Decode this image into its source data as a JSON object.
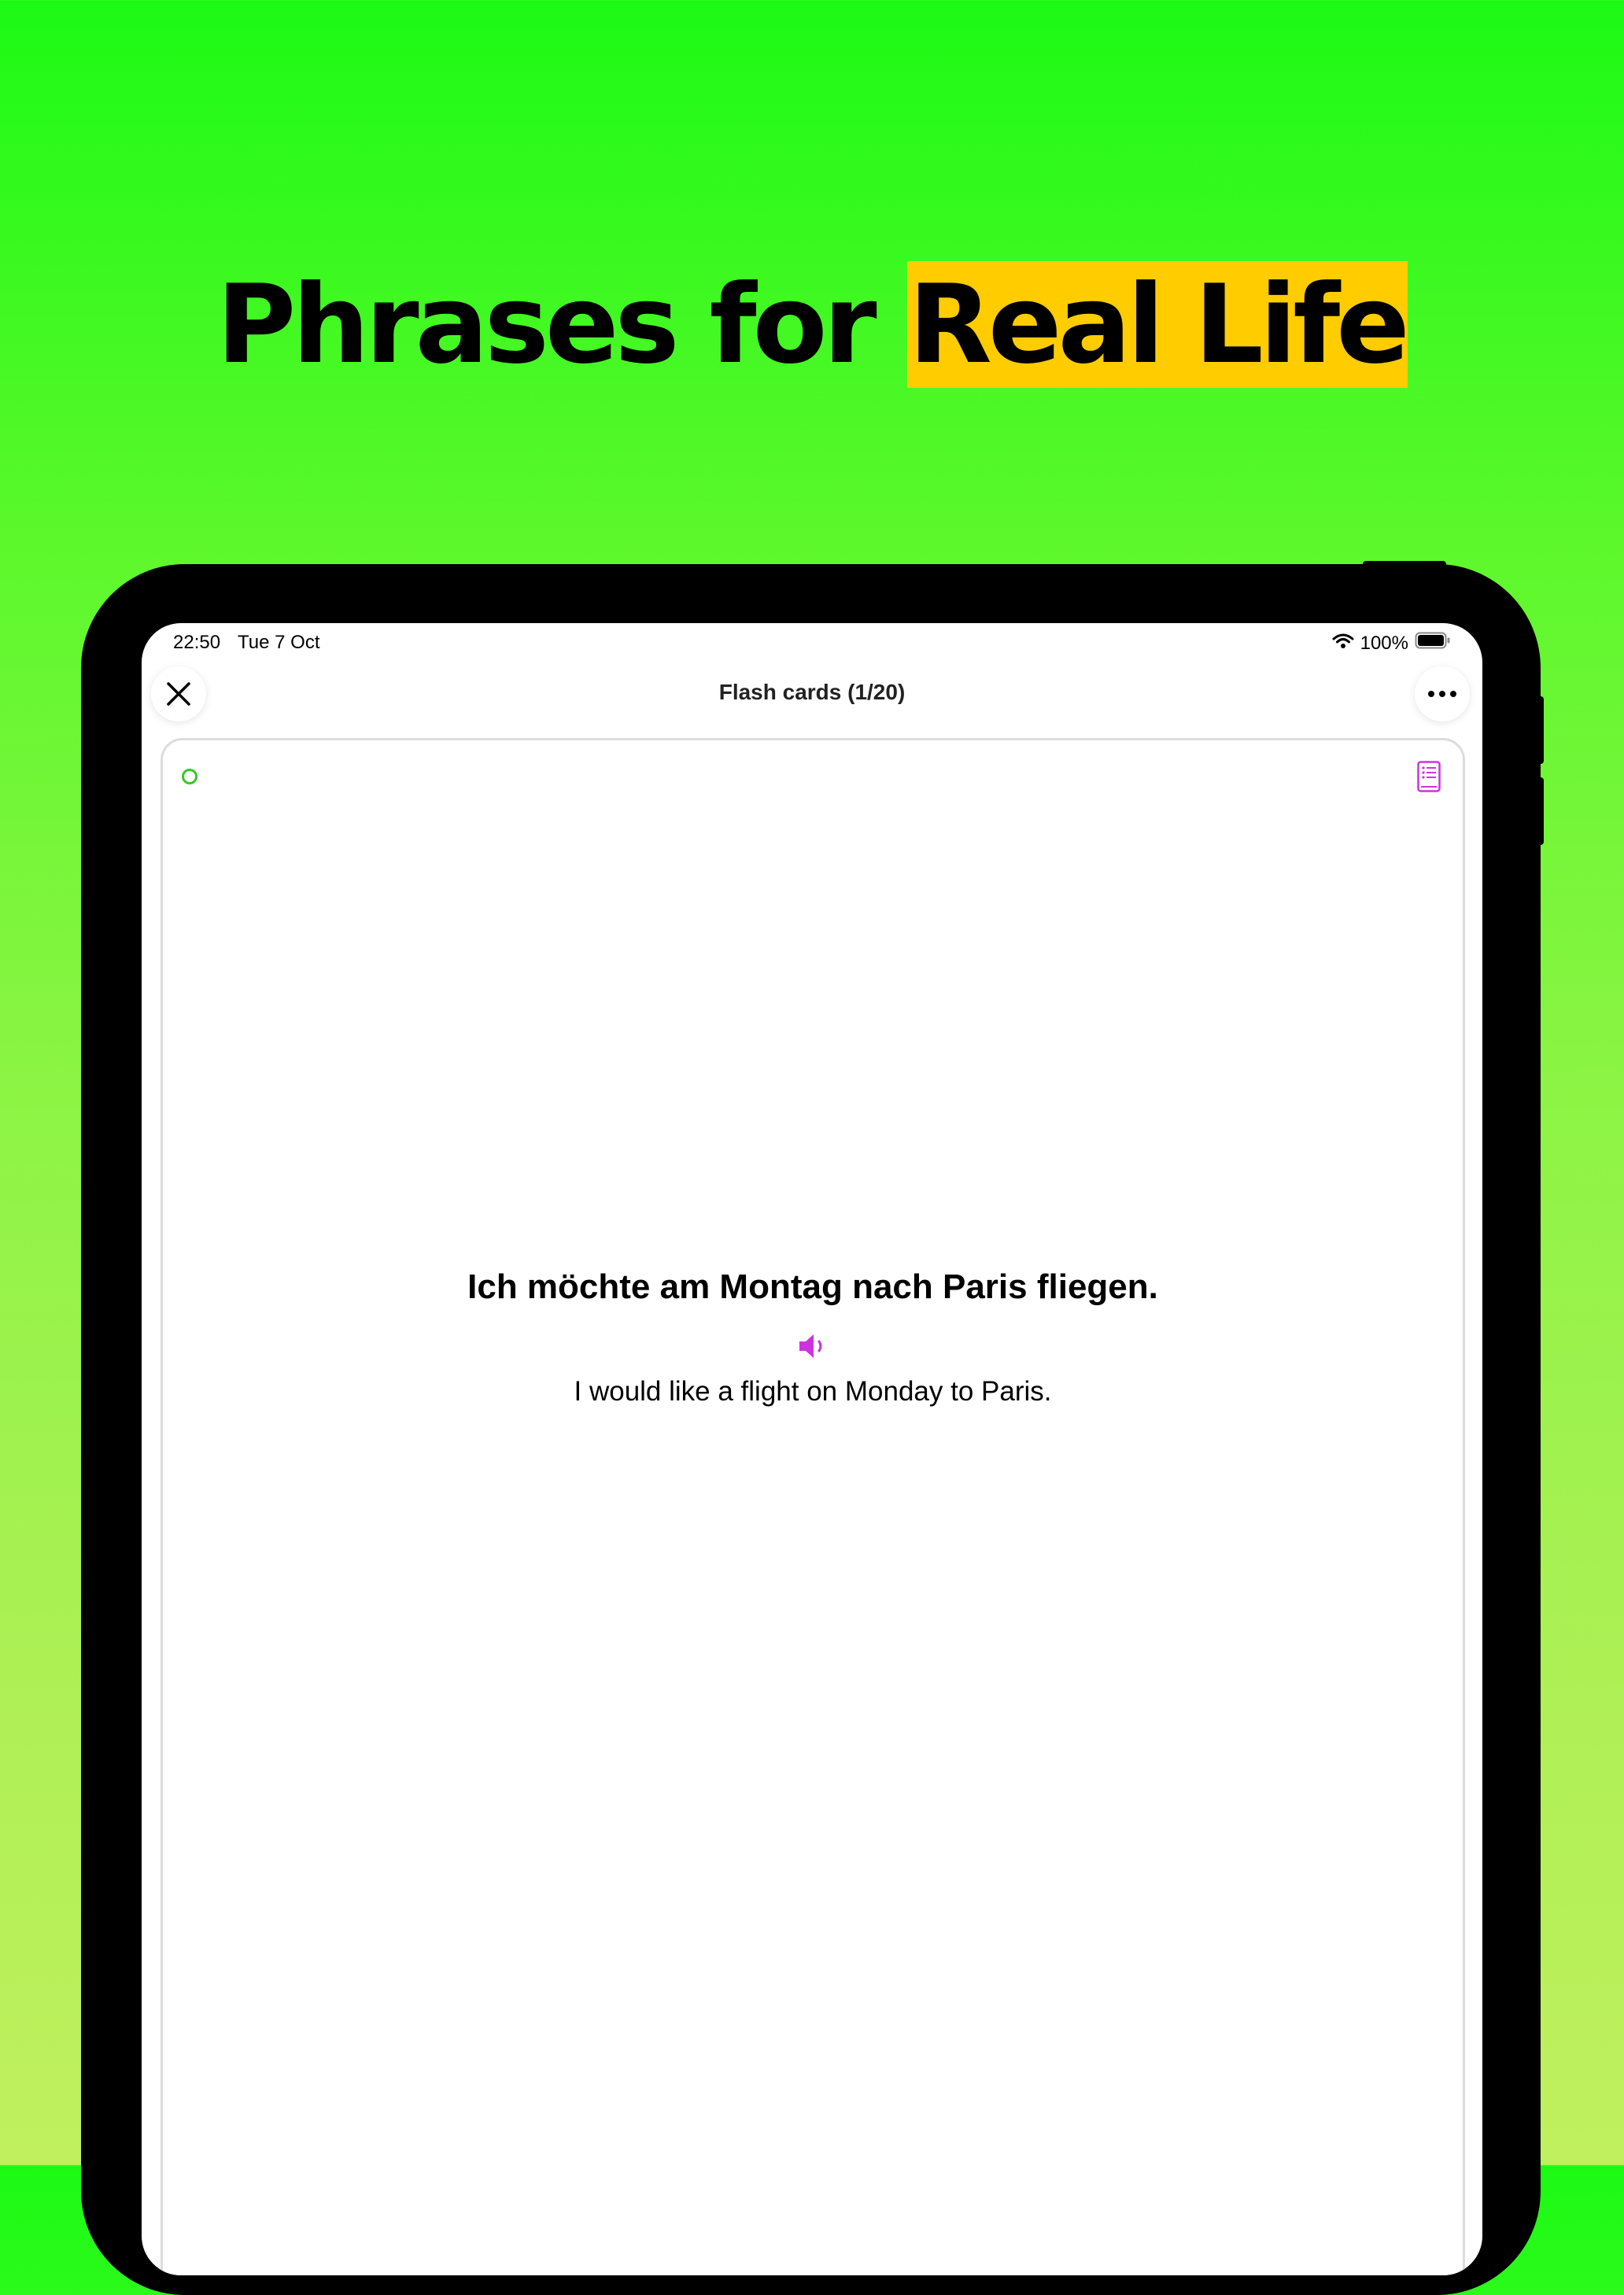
{
  "headline": {
    "prefix": "Phrases for ",
    "highlight": "Real Life",
    "highlight_color": "#ffcc00"
  },
  "status_bar": {
    "time": "22:50",
    "date": "Tue 7 Oct",
    "battery": "100%"
  },
  "nav": {
    "title": "Flash cards (1/20)",
    "close_icon": "close-icon",
    "more_icon": "more-icon"
  },
  "card": {
    "phrase_de": "Ich möchte am Montag nach Paris fliegen.",
    "phrase_en": "I would like a flight on Monday to Paris.",
    "accent_color": "#cc33dd",
    "status_color": "#33cc22"
  },
  "colors": {
    "background_top": "#1cfa14",
    "background_bottom": "#c0f05e"
  }
}
